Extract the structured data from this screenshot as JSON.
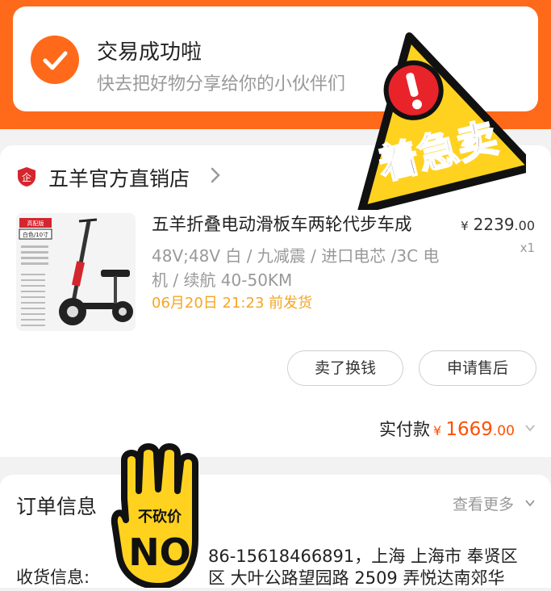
{
  "header": {
    "title": "交易成功啦",
    "subtitle": "快去把好物分享给你的小伙伴们"
  },
  "shop": {
    "logo_text": "企",
    "name": "五羊官方直销店"
  },
  "product": {
    "thumb_badge": "高配版",
    "thumb_variant": "白色/10寸",
    "title": "五羊折叠电动滑板车两轮代步车成",
    "spec": "48V;48V 白 / 九减震 / 进口电芯 /3C 电机 / 续航 40-50KM",
    "ship_time": "06月20日 21:23 前发货",
    "price_yen": "¥",
    "price_int": "2239",
    "price_cents": ".00",
    "qty": "x1"
  },
  "actions": {
    "sell_label": "卖了换钱",
    "after_sale_label": "申请售后"
  },
  "payment": {
    "label": "实付款",
    "yen": "¥",
    "amount": "1669",
    "cents": ".00"
  },
  "order_info": {
    "title": "订单信息",
    "more_label": "查看更多",
    "address_label": "收货信息:",
    "address_line1": "86-15618466891，上海 上海市 奉贤区",
    "address_line2": "区 大叶公路望园路 2509 弄悦达南郊华"
  },
  "stickers": {
    "warning_text": "着急卖",
    "no_text_top": "不砍价",
    "no_text_big": "NO"
  },
  "colors": {
    "accent_orange": "#ff6a1a",
    "price_red": "#ff5000",
    "ship_yellow": "#f5a623",
    "sticker_yellow": "#ffd21f"
  }
}
